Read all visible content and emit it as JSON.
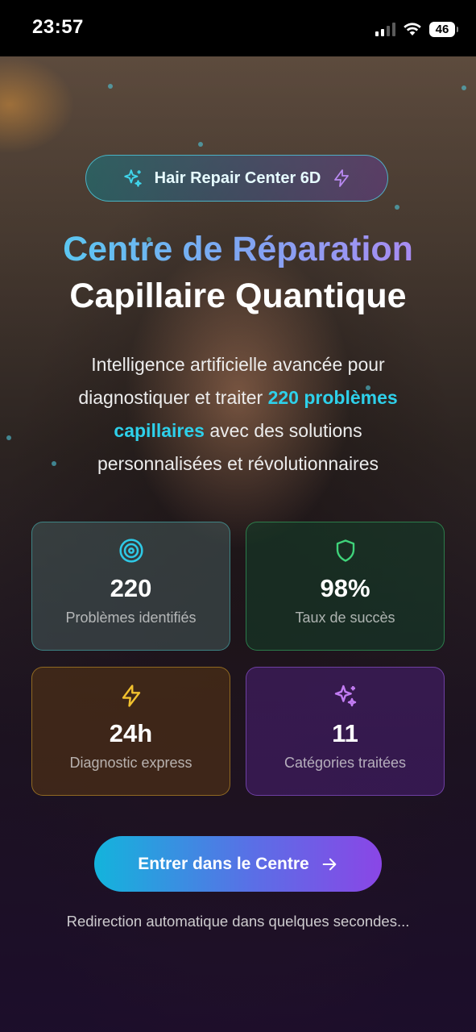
{
  "status_bar": {
    "time": "23:57",
    "battery": "46"
  },
  "badge": {
    "label": "Hair Repair Center 6D"
  },
  "hero": {
    "title_line1": "Centre de Réparation",
    "title_line2": "Capillaire Quantique",
    "desc_line1": "Intelligence artificielle avancée pour",
    "desc_line2_prefix": "diagnostiquer et traiter ",
    "desc_line2_highlight": "220 problèmes",
    "desc_line3_highlight": "capillaires",
    "desc_line3_suffix": " avec des solutions",
    "desc_line4": "personnalisées et révolutionnaires"
  },
  "stats": [
    {
      "value": "220",
      "label": "Problèmes identifiés",
      "icon": "target-icon",
      "color": "#2ec9e6"
    },
    {
      "value": "98%",
      "label": "Taux de succès",
      "icon": "shield-icon",
      "color": "#3fd37a"
    },
    {
      "value": "24h",
      "label": "Diagnostic express",
      "icon": "lightning-icon",
      "color": "#f2c12e"
    },
    {
      "value": "11",
      "label": "Catégories traitées",
      "icon": "sparkles-icon",
      "color": "#c27cf2"
    }
  ],
  "cta": {
    "label": "Entrer dans le Centre"
  },
  "footer": {
    "redirect_text": "Redirection automatique dans quelques secondes..."
  }
}
